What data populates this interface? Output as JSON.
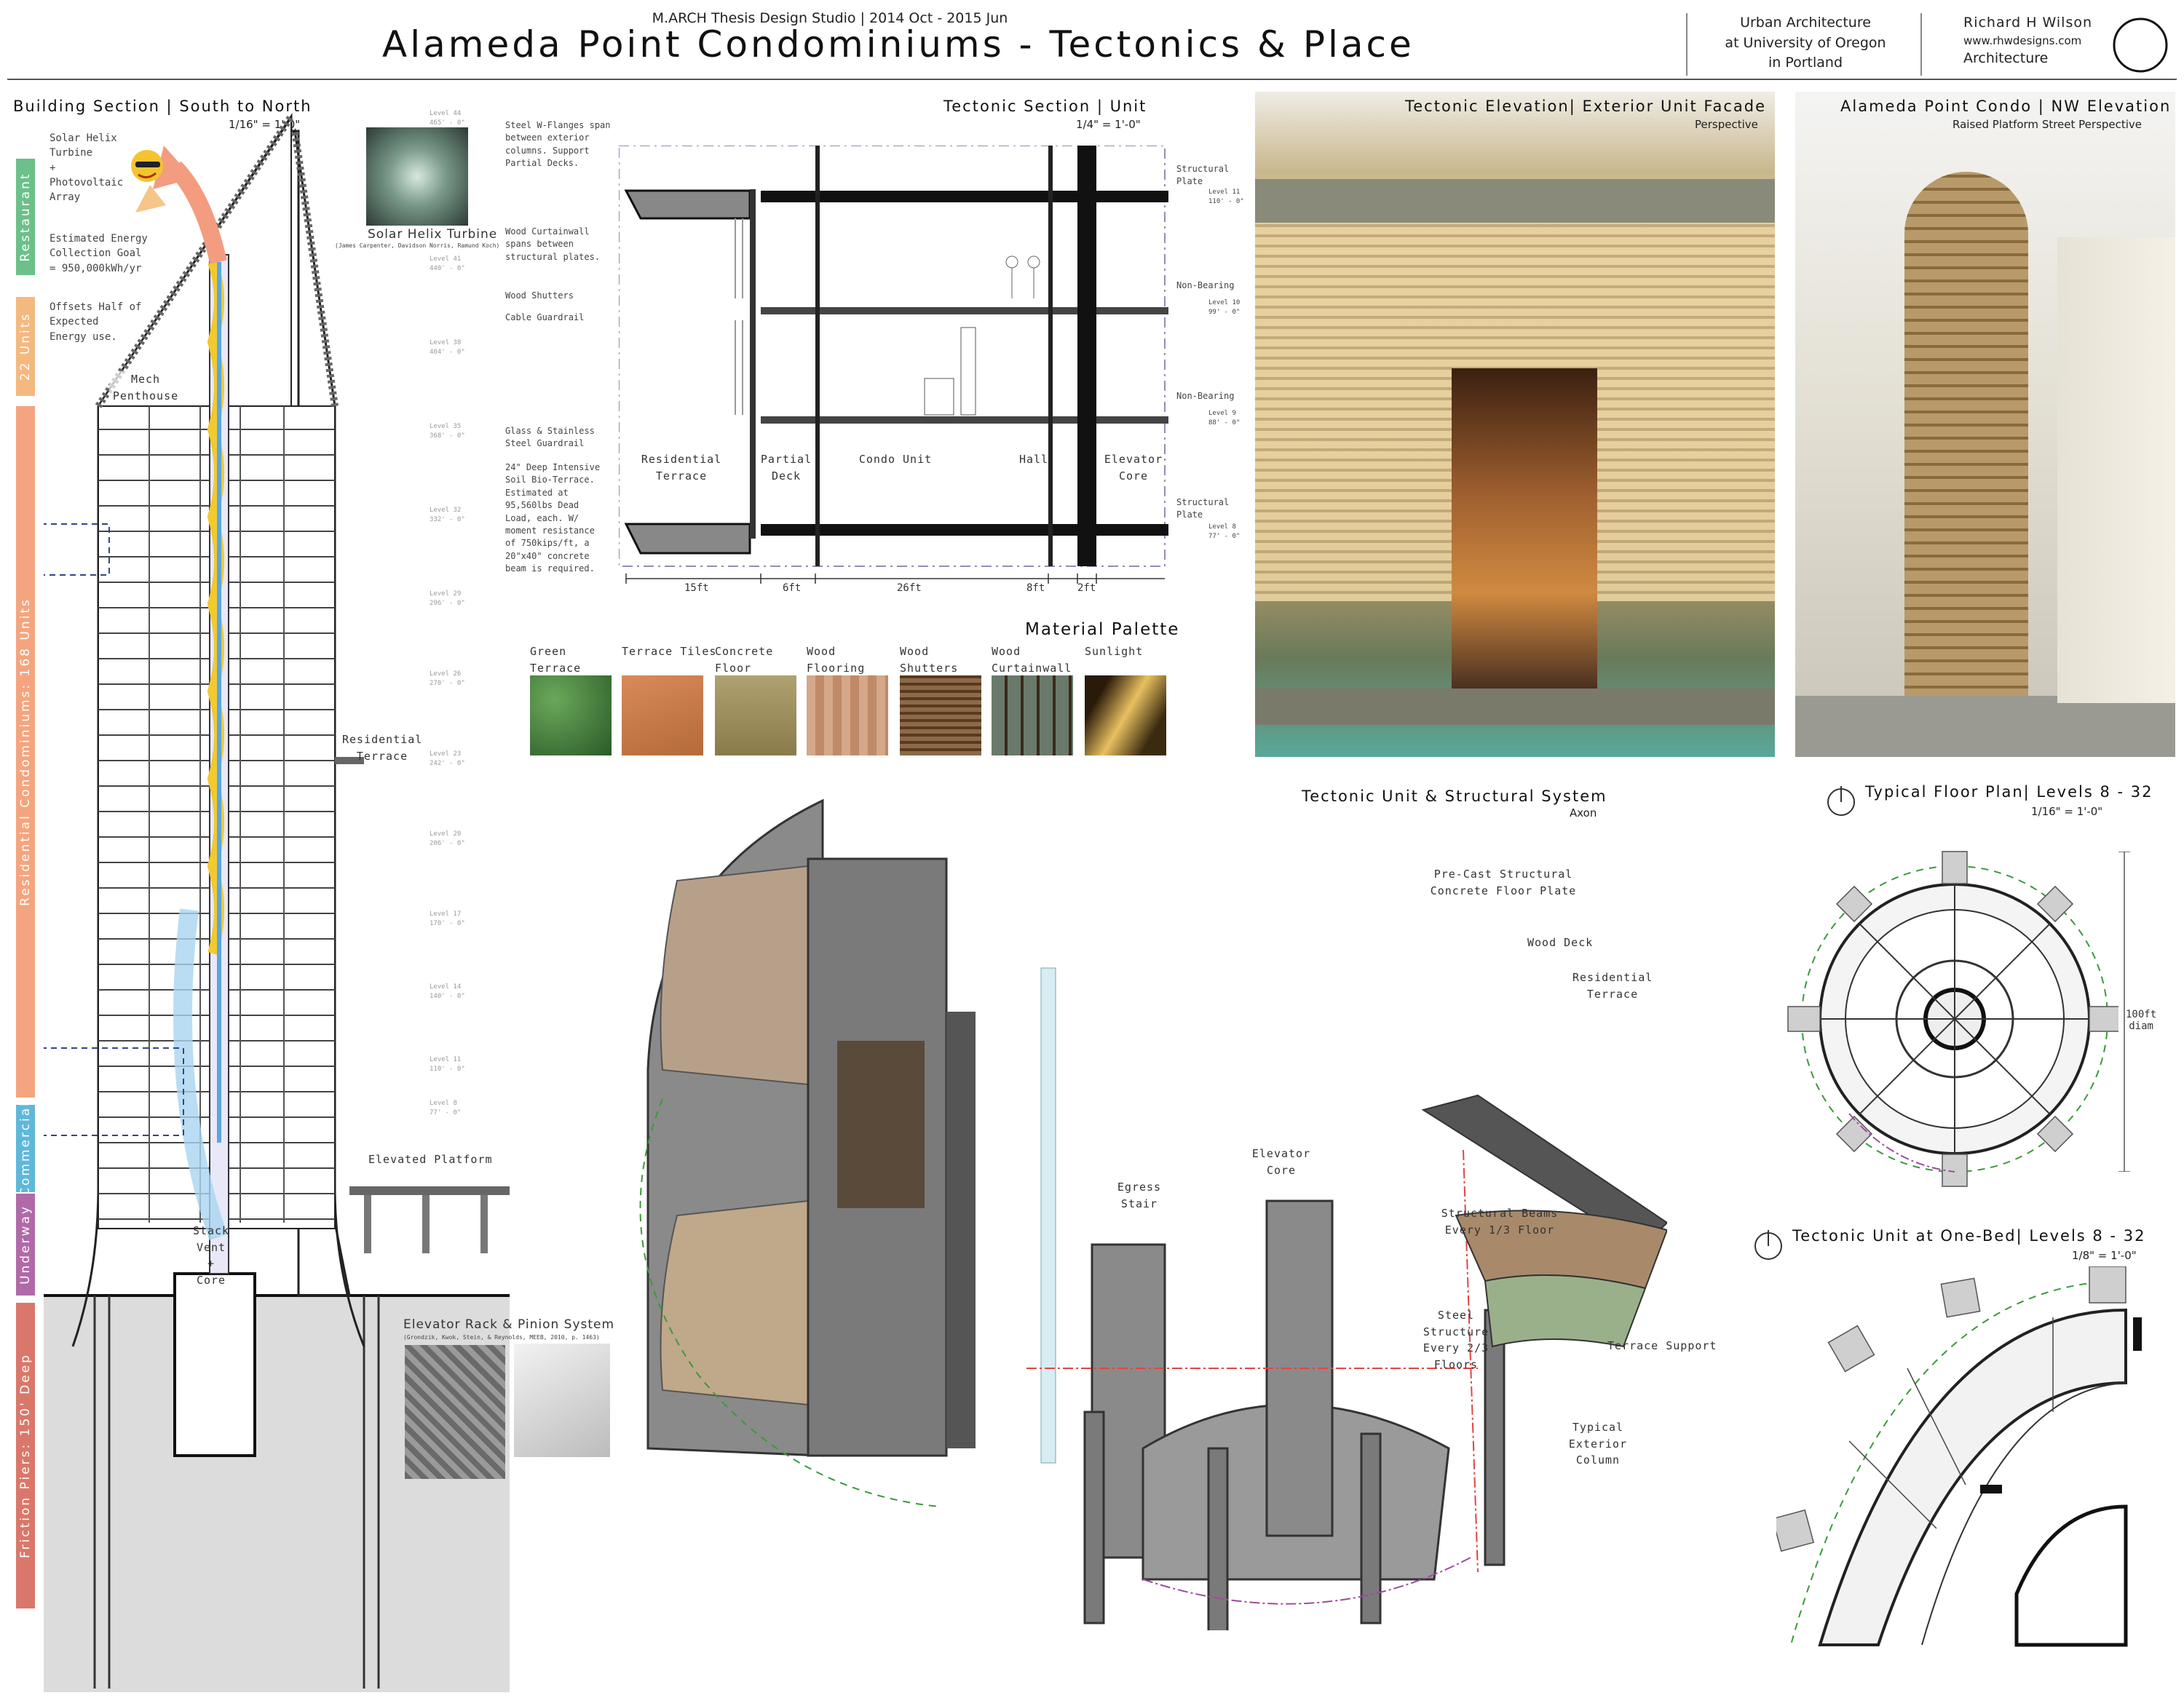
{
  "header": {
    "studio": "M.ARCH Thesis Design Studio | 2014 Oct - 2015 Jun",
    "title": "Alameda Point Condominiums - Tectonics & Place",
    "school_line1": "Urban Architecture",
    "school_line2": "at University of Oregon",
    "school_line3": "in Portland",
    "author": "Richard H Wilson",
    "website": "www.rhwdesigns.com",
    "discipline": "Architecture"
  },
  "building_section": {
    "title": "Building Section | South to North",
    "scale": "1/16\" = 1'-0\"",
    "bands": [
      "Restaurant",
      "22 Units",
      "Residential Condominiums: 168 Units",
      "Commercial",
      "Underway",
      "Friction Piers: 150' Deep"
    ],
    "band_colors": [
      "#6cc08a",
      "#f4b97f",
      "#f4a57f",
      "#5fb8d8",
      "#b06aa8",
      "#d9786a"
    ],
    "solar_note1": "Solar Helix\nTurbine\n+\nPhotovoltaic\nArray",
    "solar_note2": "Estimated Energy\nCollection Goal\n= 950,000kWh/yr",
    "solar_note3": "Offsets Half of\nExpected\nEnergy use.",
    "turbine_label": "Solar Helix Turbine",
    "turbine_credit": "(James Carpenter, Davidson Norris, Ramund Koch)",
    "mech": "Mech\nPenthouse",
    "res_terrace": "Residential\nTerrace",
    "elevated_platform": "Elevated Platform",
    "stack": "Stack\nVent\n+\nCore",
    "elevator_rack": "Elevator Rack & Pinion System",
    "elevator_credit": "(Grondzik, Kwok, Stein, & Reynolds, MEEB, 2010, p. 1463)",
    "levels": [
      "Level 44\n465' - 0\"",
      "Level 41\n440' - 0\"",
      "Level 38\n404' - 0\"",
      "Level 35\n368' - 0\"",
      "Level 32\n332' - 0\"",
      "Level 29\n296' - 0\"",
      "Level 26\n270' - 0\"",
      "Level 23\n242' - 0\"",
      "Level 20\n206' - 0\"",
      "Level 17\n170' - 0\"",
      "Level 14\n140' - 0\"",
      "Level 11\n110' - 0\"",
      "Level 8\n77' - 0\""
    ]
  },
  "tectonic_section": {
    "title": "Tectonic Section | Unit",
    "scale": "1/4\" = 1'-0\"",
    "notes": [
      "Steel W-Flanges span\nbetween exterior\ncolumns. Support\nPartial Decks.",
      "Wood Curtainwall\nspans between\nstructural plates.",
      "Wood Shutters",
      "Cable Guardrail",
      "Glass & Stainless\nSteel Guardrail",
      "24\" Deep Intensive\nSoil Bio-Terrace.\nEstimated at\n95,560lbs Dead\nLoad, each. W/\nmoment resistance\nof 750kips/ft, a\n20\"x40\" concrete\nbeam is required."
    ],
    "zones": [
      "Residential\nTerrace",
      "Partial\nDeck",
      "Condo Unit",
      "Hall",
      "Elevator\nCore"
    ],
    "dims": [
      "15ft",
      "6ft",
      "26ft",
      "8ft",
      "2ft"
    ],
    "right_labels": [
      "Structural\nPlate",
      "Non-Bearing",
      "Non-Bearing",
      "Structural\nPlate"
    ],
    "right_levels": [
      "Level 11\n110' - 0\"",
      "Level 10\n99' - 0\"",
      "Level 9\n88' - 0\"",
      "Level 8\n77' - 0\""
    ]
  },
  "material_palette": {
    "title": "Material Palette",
    "items": [
      {
        "label": "Green\nTerrace",
        "color": "#3d7a3a"
      },
      {
        "label": "Terrace Tiles",
        "color": "#c47a4a"
      },
      {
        "label": "Concrete\nFloor",
        "color": "#a89a6a"
      },
      {
        "label": "Wood\nFlooring",
        "color": "#c89a78"
      },
      {
        "label": "Wood\nShutters",
        "color": "#7a5a3a"
      },
      {
        "label": "Wood\nCurtainwall",
        "color": "#5a6a5a"
      },
      {
        "label": "Sunlight",
        "color": "#c9a050"
      }
    ]
  },
  "tectonic_elevation": {
    "title": "Tectonic Elevation| Exterior Unit Facade",
    "subtitle": "Perspective"
  },
  "nw_elevation": {
    "title": "Alameda Point Condo | NW Elevation",
    "subtitle": "Raised Platform Street Perspective"
  },
  "axon": {
    "title": "Tectonic Unit & Structural System",
    "subtitle": "Axon",
    "labels": {
      "precast": "Pre-Cast Structural\nConcrete Floor Plate",
      "wood_deck": "Wood Deck",
      "res_terrace": "Residential\nTerrace",
      "elevator_core": "Elevator\nCore",
      "egress": "Egress\nStair",
      "beams": "Structural Beams\nEvery 1/3 Floor",
      "steel": "Steel\nStructure\nEvery 2/3\nFloors",
      "terrace_support": "Terrace Support",
      "ext_column": "Typical Exterior\nColumn"
    }
  },
  "floor_plan": {
    "title": "Typical Floor Plan| Levels 8 - 32",
    "scale": "1/16\" = 1'-0\"",
    "diam": "100ft\ndiam"
  },
  "unit_plan": {
    "title": "Tectonic Unit at One-Bed| Levels 8 - 32",
    "scale": "1/8\" = 1'-0\""
  }
}
